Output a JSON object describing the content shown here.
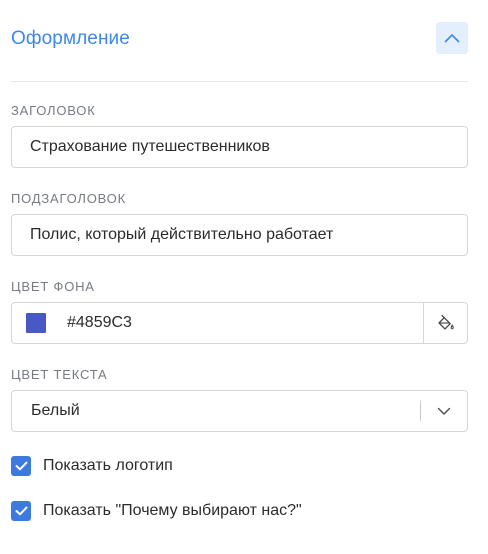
{
  "section": {
    "title": "Оформление"
  },
  "title_field": {
    "label": "ЗАГОЛОВОК",
    "value": "Страхование путешественников"
  },
  "subtitle_field": {
    "label": "ПОДЗАГОЛОВОК",
    "value": "Полис, который действительно работает"
  },
  "bg_color": {
    "label": "ЦВЕТ ФОНА",
    "value": "#4859C3",
    "swatch": "#4859C3",
    "picker_icon": "paint-bucket-icon"
  },
  "text_color": {
    "label": "ЦВЕТ ТЕКСТА",
    "selected": "Белый"
  },
  "checkboxes": [
    {
      "label": "Показать логотип",
      "checked": true
    },
    {
      "label": "Показать \"Почему выбирают нас?\"",
      "checked": true
    }
  ],
  "accent": "#3D88EA",
  "checkbox_color": "#3D7AE0"
}
